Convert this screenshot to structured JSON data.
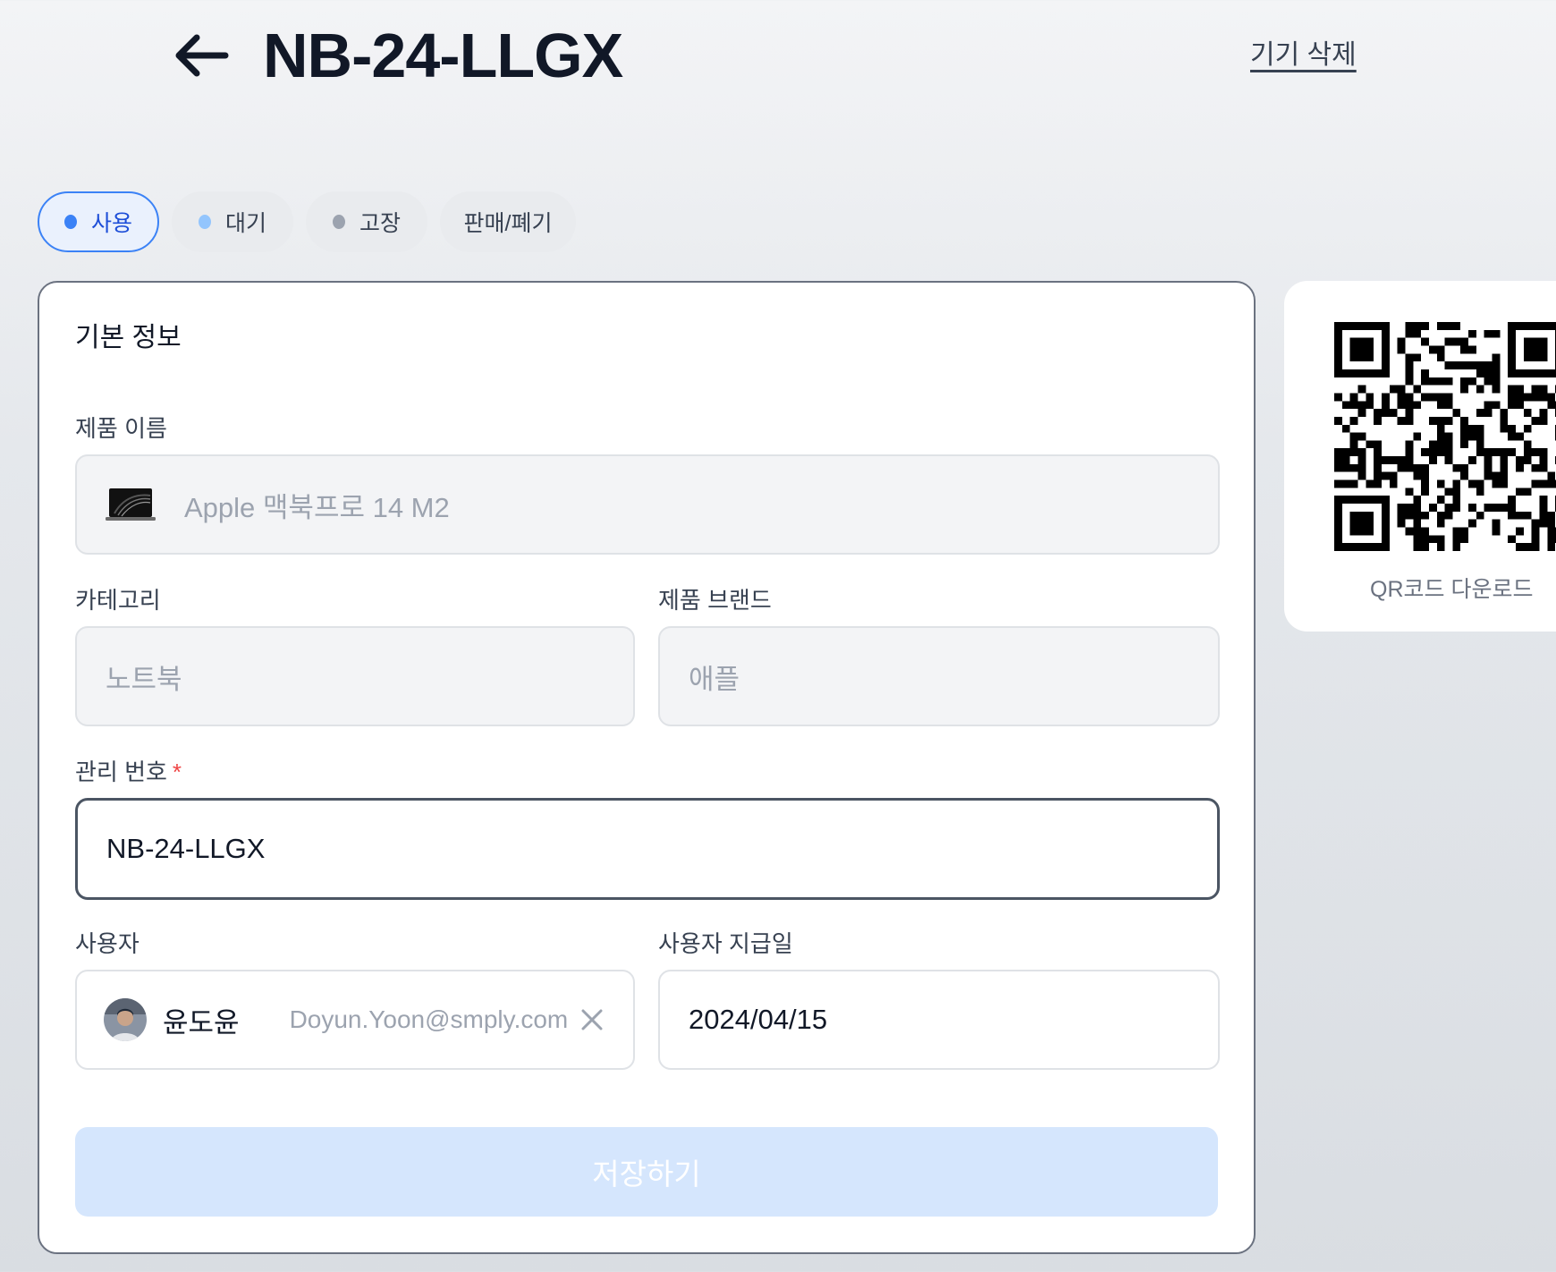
{
  "header": {
    "title": "NB-24-LLGX",
    "delete_label": "기기 삭제"
  },
  "status_chips": [
    {
      "label": "사용",
      "dot_color": "#3b82f6",
      "active": true
    },
    {
      "label": "대기",
      "dot_color": "#93c5fd",
      "active": false
    },
    {
      "label": "고장",
      "dot_color": "#9ca3af",
      "active": false
    },
    {
      "label": "판매/폐기",
      "dot_color": null,
      "active": false
    }
  ],
  "basic_info": {
    "section_title": "기본 정보",
    "product_name_label": "제품 이름",
    "product_name_value": "Apple 맥북프로 14 M2",
    "category_label": "카테고리",
    "category_value": "노트북",
    "brand_label": "제품 브랜드",
    "brand_value": "애플",
    "mgmt_no_label": "관리 번호",
    "mgmt_no_required": "*",
    "mgmt_no_value": "NB-24-LLGX",
    "user_label": "사용자",
    "user_name": "윤도윤",
    "user_email": "Doyun.Yoon@smply.com",
    "issue_date_label": "사용자 지급일",
    "issue_date_value": "2024/04/15",
    "save_label": "저장하기"
  },
  "qr": {
    "download_label": "QR코드 다운로드"
  },
  "colors": {
    "accent": "#3b82f6",
    "required": "#ef4444",
    "save_disabled_bg": "#d5e6fd"
  }
}
